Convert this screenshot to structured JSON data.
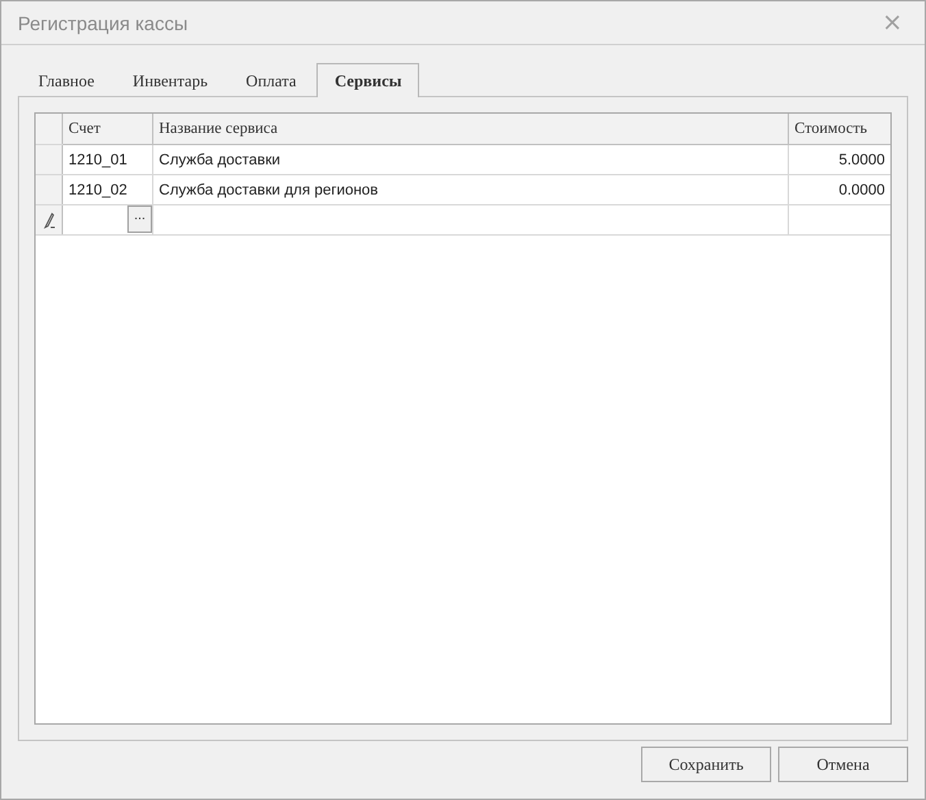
{
  "window": {
    "title": "Регистрация кассы",
    "close": "×"
  },
  "tabs": [
    {
      "label": "Главное",
      "selected": false
    },
    {
      "label": "Инвентарь",
      "selected": false
    },
    {
      "label": "Оплата",
      "selected": false
    },
    {
      "label": "Сервисы",
      "selected": true
    }
  ],
  "table": {
    "columns": [
      "Счет",
      "Название сервиса",
      "Стоимость"
    ],
    "rows": [
      {
        "account": "1210_01",
        "name": "Служба доставки",
        "cost": "5.0000"
      },
      {
        "account": "1210_02",
        "name": "Служба доставки для регионов",
        "cost": "0.0000"
      }
    ],
    "new_row": {
      "ellipsis_button": "..."
    }
  },
  "buttons": [
    "Сохранить",
    "Отмена"
  ]
}
